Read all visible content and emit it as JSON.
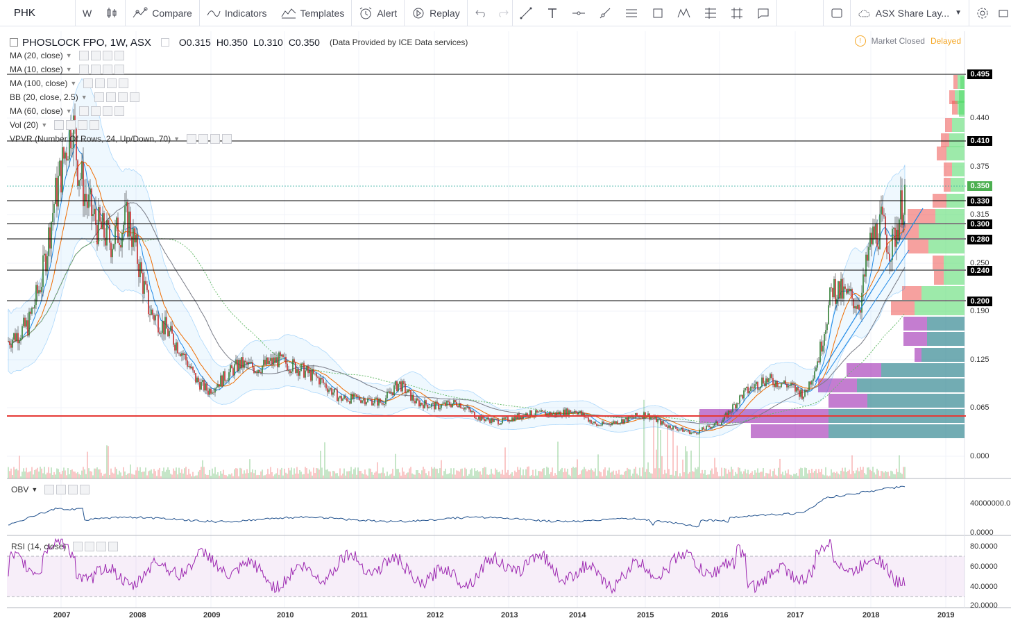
{
  "toolbar": {
    "symbol": "PHK",
    "interval": "W",
    "compare": "Compare",
    "indicators": "Indicators",
    "templates": "Templates",
    "alert": "Alert",
    "replay": "Replay",
    "layout": "ASX Share Lay..."
  },
  "legend": {
    "title": "PHOSLOCK FPO, 1W, ASX",
    "open": "O0.315",
    "high": "H0.350",
    "low": "L0.310",
    "close": "C0.350",
    "provider": "(Data Provided by ICE Data services)",
    "indicators": [
      "MA (20, close)",
      "MA (10, close)",
      "MA (100, close)",
      "BB (20, close, 2.5)",
      "MA (60, close)",
      "Vol (20)",
      "VPVR (Number Of Rows, 24, Up/Down, 70)"
    ]
  },
  "status": {
    "market": "Market Closed",
    "delayed": "Delayed"
  },
  "price_axis": [
    "0.440",
    "0.375",
    "0.315",
    "0.250",
    "0.190",
    "0.125",
    "0.065",
    "0.000"
  ],
  "price_levels": [
    "0.495",
    "0.410",
    "0.350",
    "0.330",
    "0.300",
    "0.280",
    "0.240",
    "0.200"
  ],
  "x_axis": [
    "2007",
    "2008",
    "2009",
    "2010",
    "2011",
    "2012",
    "2013",
    "2014",
    "2015",
    "2016",
    "2017",
    "2018",
    "2019"
  ],
  "obv": {
    "label": "OBV",
    "axis": [
      "40000000.0",
      "0.0000"
    ]
  },
  "rsi": {
    "label": "RSI (14, close)",
    "axis": [
      "80.0000",
      "60.0000",
      "40.0000",
      "20.0000"
    ]
  },
  "colors": {
    "up": "#2e7d32",
    "down": "#c62828",
    "support": "#e53935",
    "rsi": "#9c27b0",
    "obv": "#1e4f8c"
  }
}
